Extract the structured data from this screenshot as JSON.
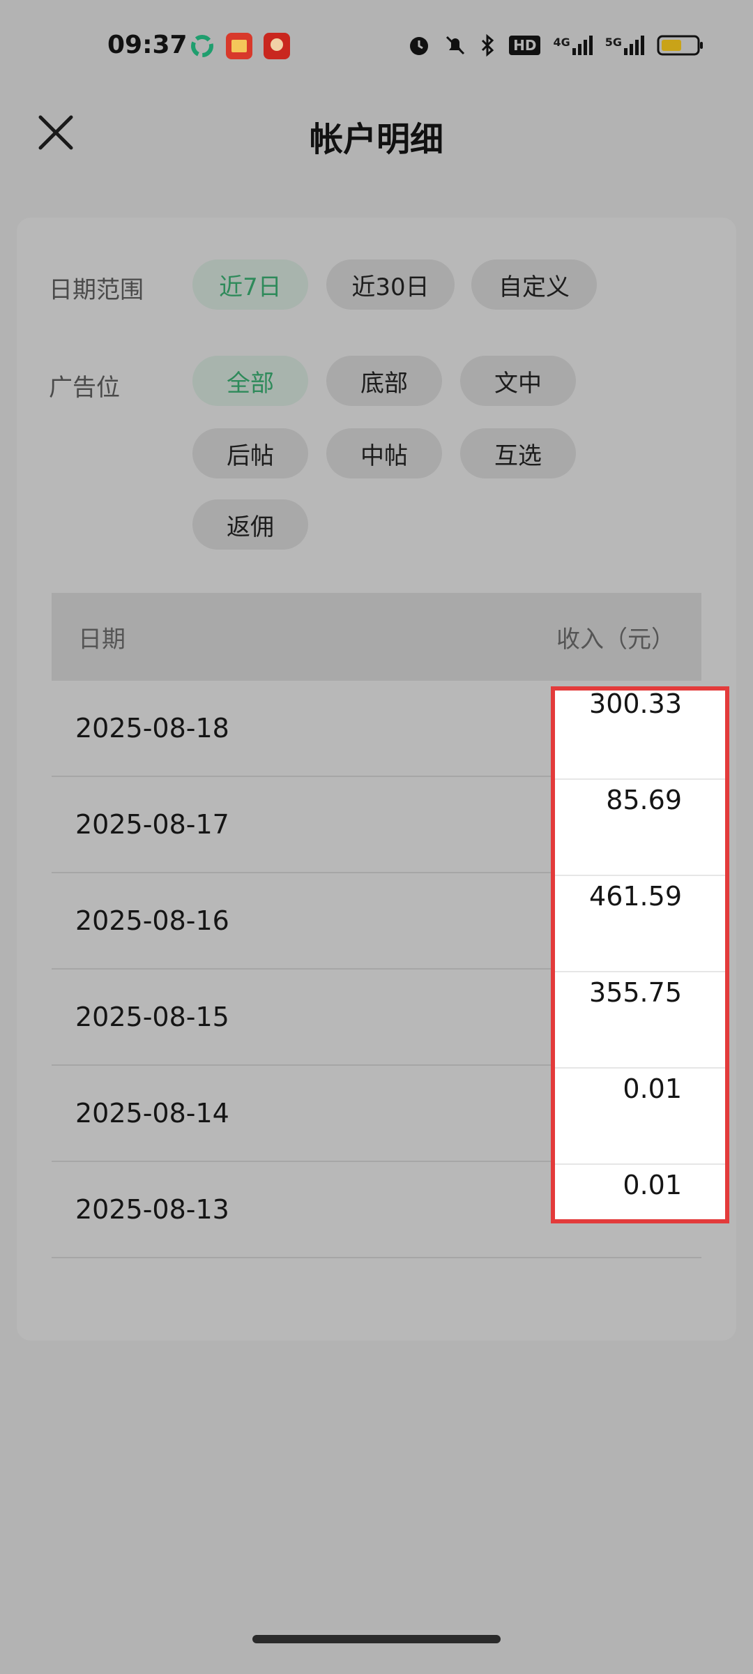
{
  "status_bar": {
    "time": "09:37",
    "icons": [
      "recycle-app-icon",
      "app-icon-red",
      "app-icon-red-2",
      "alarm-icon",
      "mute-icon",
      "bluetooth-icon",
      "hd-icon",
      "signal-4g-icon",
      "signal-5g-icon",
      "battery-icon"
    ],
    "hd_label": "HD",
    "net1": "4G",
    "net2": "5G"
  },
  "header": {
    "title": "帐户明细"
  },
  "filters": {
    "date_range_label": "日期范围",
    "date_options": [
      "近7日",
      "近30日",
      "自定义"
    ],
    "ad_slot_label": "广告位",
    "ad_options": [
      "全部",
      "底部",
      "文中",
      "后帖",
      "中帖",
      "互选",
      "返佣"
    ]
  },
  "table": {
    "headers": [
      "日期",
      "收入（元）"
    ],
    "rows": [
      {
        "date": "2025-08-18",
        "amount": "300.33"
      },
      {
        "date": "2025-08-17",
        "amount": "85.69"
      },
      {
        "date": "2025-08-16",
        "amount": "461.59"
      },
      {
        "date": "2025-08-15",
        "amount": "355.75"
      },
      {
        "date": "2025-08-14",
        "amount": "0.01"
      },
      {
        "date": "2025-08-13",
        "amount": "0.01"
      }
    ]
  },
  "colors": {
    "active_chip_text": "#2e8a5a",
    "highlight_border": "#e33b3b"
  }
}
